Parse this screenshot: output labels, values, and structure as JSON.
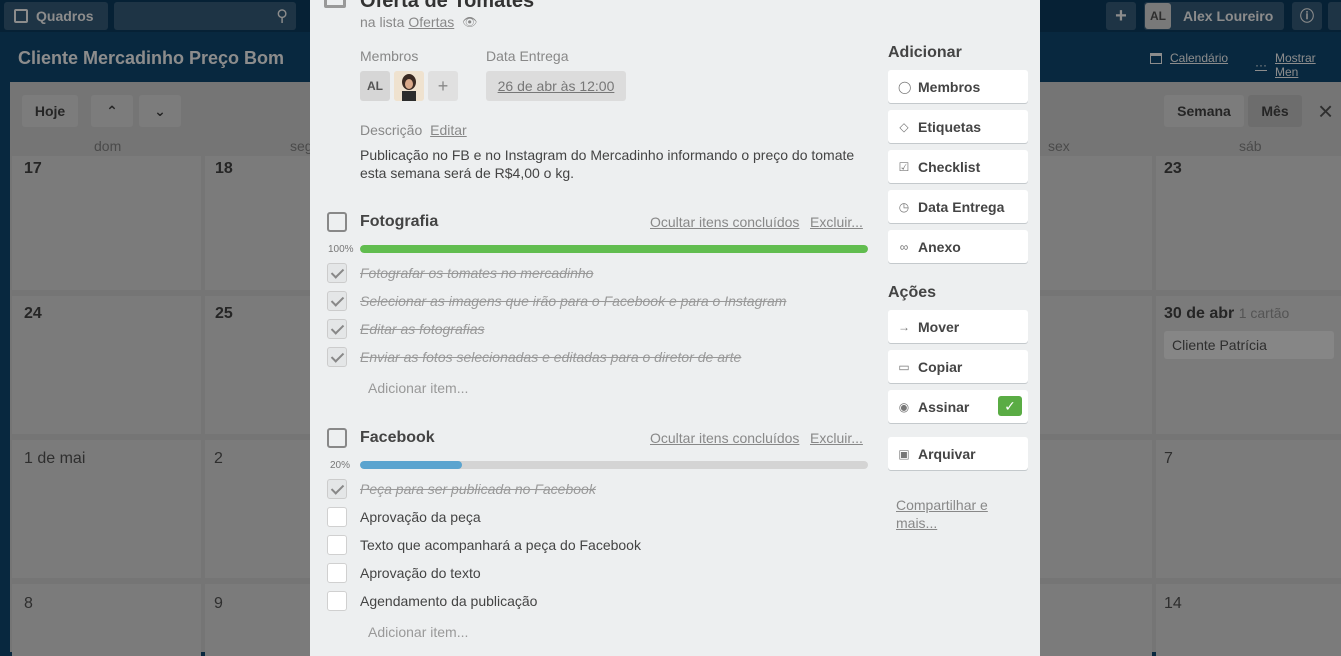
{
  "topbar": {
    "boards_label": "Quadros",
    "user_initials": "AL",
    "user_name": "Alex Loureiro"
  },
  "board": {
    "title": "Cliente Mercadinho Preço Bom",
    "calendar_link": "Calendário",
    "menu_link": "Mostrar Men"
  },
  "calendar": {
    "today_label": "Hoje",
    "week_label": "Semana",
    "month_label": "Mês",
    "days_of_week": [
      "dom",
      "seg",
      "sex",
      "sáb"
    ],
    "row1": [
      "17",
      "18",
      "23"
    ],
    "row2": [
      "24",
      "25"
    ],
    "row2_last": {
      "day": "30 de abr",
      "count": "1 cartão",
      "card": "Cliente Patrícia"
    },
    "row3": [
      "1 de mai",
      "2",
      "7"
    ],
    "row4": [
      "8",
      "9",
      "14"
    ]
  },
  "card": {
    "title": "Oferta de Tomates",
    "in_list_prefix": "na lista",
    "list_name": "Ofertas",
    "members_label": "Membros",
    "member_initials": "AL",
    "due_label": "Data Entrega",
    "due_value": "26 de abr às 12:00",
    "description_label": "Descrição",
    "description_edit": "Editar",
    "description_text": "Publicação no FB e no Instagram do Mercadinho informando o preço do tomate esta semana será de R$4,00 o kg."
  },
  "checklists": [
    {
      "title": "Fotografia",
      "hide_link": "Ocultar itens concluídos",
      "delete_link": "Excluir...",
      "percent_label": "100%",
      "progress": 1.0,
      "color": "#61bd4f",
      "items": [
        {
          "text": "Fotografar os tomates no mercadinho",
          "done": true
        },
        {
          "text": "Selecionar as imagens que irão para o Facebook e para o Instagram",
          "done": true
        },
        {
          "text": "Editar as fotografias",
          "done": true
        },
        {
          "text": "Enviar as fotos selecionadas e editadas para o diretor de arte",
          "done": true
        }
      ],
      "add_item": "Adicionar item..."
    },
    {
      "title": "Facebook",
      "hide_link": "Ocultar itens concluídos",
      "delete_link": "Excluir...",
      "percent_label": "20%",
      "progress": 0.2,
      "color": "#5ba4cf",
      "items": [
        {
          "text": "Peça para ser publicada no Facebook",
          "done": true
        },
        {
          "text": "Aprovação da peça",
          "done": false
        },
        {
          "text": "Texto que acompanhará a peça do Facebook",
          "done": false
        },
        {
          "text": "Aprovação do texto",
          "done": false
        },
        {
          "text": "Agendamento da publicação",
          "done": false
        }
      ],
      "add_item": "Adicionar item..."
    }
  ],
  "sidebar": {
    "add_title": "Adicionar",
    "add_buttons": [
      {
        "label": "Membros",
        "icon": "person-icon"
      },
      {
        "label": "Etiquetas",
        "icon": "tag-icon"
      },
      {
        "label": "Checklist",
        "icon": "checkbox-icon"
      },
      {
        "label": "Data Entrega",
        "icon": "clock-icon"
      },
      {
        "label": "Anexo",
        "icon": "paperclip-icon"
      }
    ],
    "actions_title": "Ações",
    "action_buttons": [
      {
        "label": "Mover",
        "icon": "arrow-right-icon"
      },
      {
        "label": "Copiar",
        "icon": "copy-icon"
      },
      {
        "label": "Assinar",
        "icon": "eye-icon"
      },
      {
        "label": "Arquivar",
        "icon": "archive-icon"
      }
    ],
    "share": "Compartilhar e mais..."
  }
}
